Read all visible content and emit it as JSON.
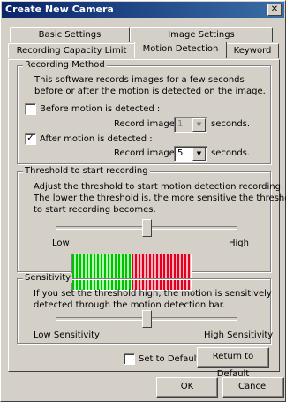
{
  "window": {
    "title": "Create New Camera",
    "close_glyph": "✕"
  },
  "tabs": {
    "row1": [
      "Basic Settings",
      "Image Settings"
    ],
    "row2": [
      "Recording Capacity Limit",
      "Motion Detection",
      "Keyword"
    ],
    "active": "Motion Detection"
  },
  "recording_method": {
    "legend": "Recording Method",
    "description_line1": "This software records images for a few seconds",
    "description_line2": "before or after the motion is detected on the image.",
    "before": {
      "label": "Before motion is detected :",
      "checked": false,
      "record_label": "Record images for",
      "value": "1",
      "unit": "seconds.",
      "enabled": false
    },
    "after": {
      "label": "After motion is detected :",
      "checked": true,
      "record_label": "Record images for",
      "value": "5",
      "unit": "seconds.",
      "enabled": true
    }
  },
  "threshold": {
    "legend": "Threshold to start recording",
    "description_line1": "Adjust the threshold to start motion detection recording.",
    "description_line2": "The lower the threshold is, the more sensitive the threshold",
    "description_line3": "to start recording becomes.",
    "low_label": "Low",
    "high_label": "High",
    "slider_level": 0.5,
    "meter_split": 0.5,
    "colors": {
      "below": "#00c000",
      "above": "#e00020"
    }
  },
  "sensitivity": {
    "legend": "Sensitivity",
    "description_line1": "If you set the threshold high, the motion is sensitively",
    "description_line2": "detected through the motion detection bar.",
    "low_label": "Low Sensitivity",
    "high_label": "High Sensitivity",
    "slider_level": 0.5
  },
  "set_to_default": {
    "label": "Set to Default",
    "checked": false
  },
  "buttons": {
    "return_default": "Return to Default",
    "ok": "OK",
    "cancel": "Cancel"
  },
  "check_glyph": "✓",
  "combo_arrow": "▼"
}
